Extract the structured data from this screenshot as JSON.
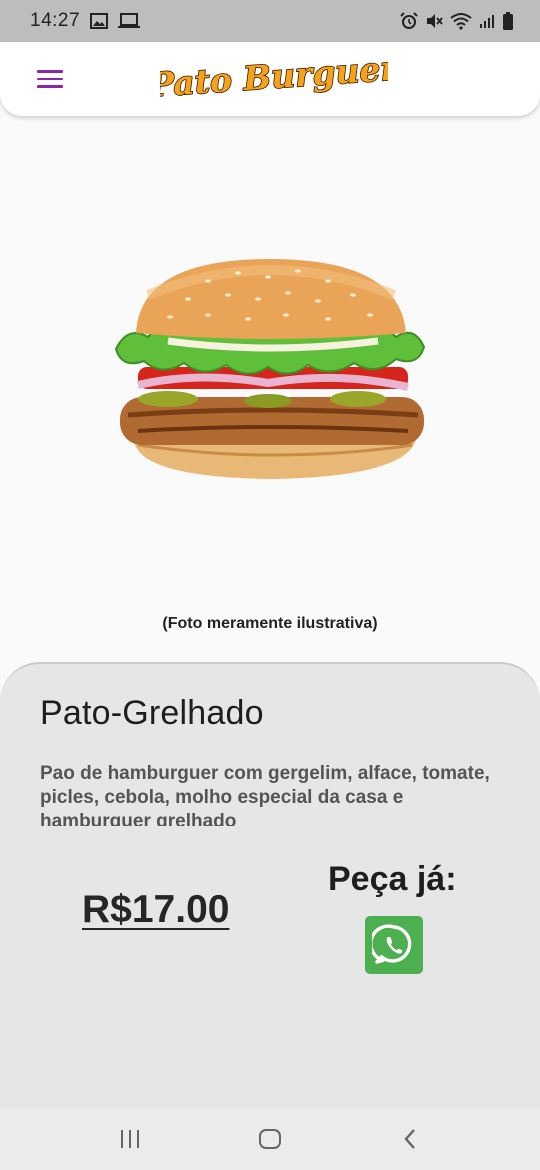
{
  "status_bar": {
    "time": "14:27",
    "left_icons": [
      "image-icon",
      "cast-icon"
    ],
    "right_icons": [
      "alarm-icon",
      "mute-icon",
      "wifi-icon",
      "signal-icon",
      "battery-icon"
    ]
  },
  "app_bar": {
    "menu_icon": "hamburger-menu-icon",
    "logo_text": "Pato Burguer"
  },
  "product": {
    "image_icon": "burger-image",
    "photo_note": "(Foto meramente ilustrativa)",
    "name": "Pato-Grelhado",
    "description": "Pao de hamburguer com gergelim, alface, tomate, picles, cebola, molho especial da casa e hamburguer grelhado",
    "price": "R$17.00",
    "order_label": "Peça já:",
    "order_icon": "whatsapp-icon"
  },
  "nav_bar": {
    "icons": [
      "recent-apps-icon",
      "home-icon",
      "back-icon"
    ]
  },
  "colors": {
    "accent": "#8e24aa",
    "logo_fill": "#f7a21b",
    "whatsapp": "#4caf50",
    "panel": "#e6e6e6"
  }
}
